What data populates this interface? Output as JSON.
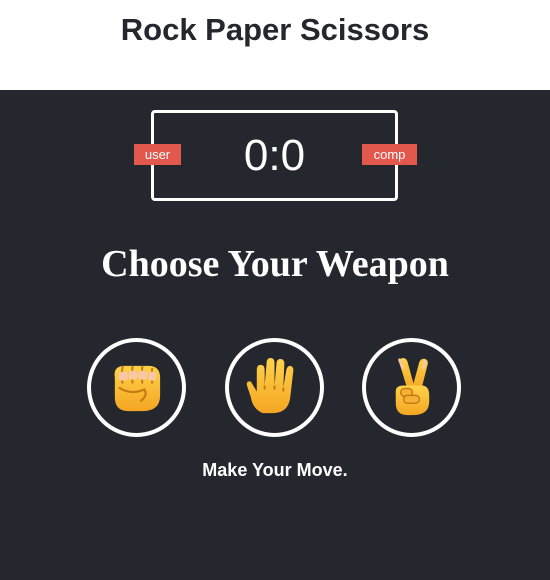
{
  "header": {
    "title": "Rock Paper Scissors"
  },
  "scoreboard": {
    "user_label": "user",
    "comp_label": "comp",
    "score": "0:0"
  },
  "game": {
    "heading": "Choose Your Weapon",
    "message": "Make Your Move.",
    "choices": [
      {
        "name": "rock",
        "icon": "fist-icon"
      },
      {
        "name": "paper",
        "icon": "raised-hand-icon"
      },
      {
        "name": "scissors",
        "icon": "victory-hand-icon"
      }
    ]
  },
  "colors": {
    "background": "#24272e",
    "badge": "#e2584d",
    "text": "#ffffff",
    "title": "#24272e"
  }
}
